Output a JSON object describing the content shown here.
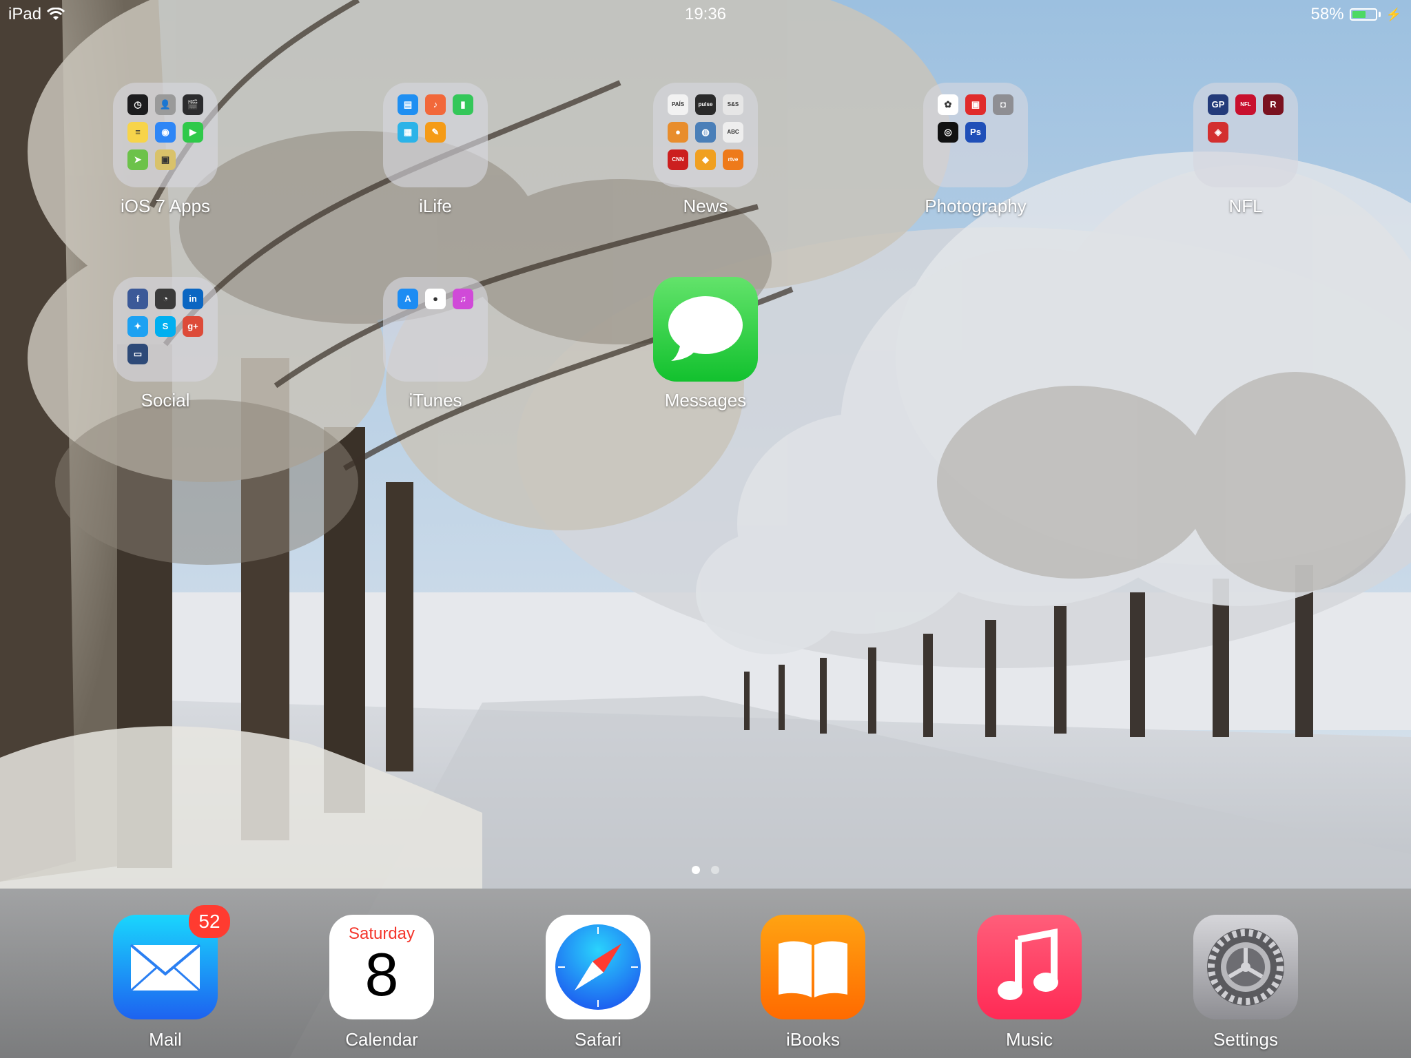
{
  "status_bar": {
    "device": "iPad",
    "time": "19:36",
    "battery": "58%",
    "battery_level": 0.58
  },
  "folders": [
    {
      "label": "iOS 7 Apps",
      "minis": [
        {
          "icon": "clock-icon",
          "color": "#1c1c1e",
          "glyph": "◷"
        },
        {
          "icon": "contacts-icon",
          "color": "#9a9a9a",
          "glyph": "👤"
        },
        {
          "icon": "videos-icon",
          "color": "#2c2c2e",
          "glyph": "🎬"
        },
        {
          "icon": "notes-icon",
          "color": "#f7d44a",
          "glyph": "≡"
        },
        {
          "icon": "wifi-icon",
          "color": "#2e86f6",
          "glyph": "◉"
        },
        {
          "icon": "facetime-icon",
          "color": "#2fc94a",
          "glyph": "▶"
        },
        {
          "icon": "maps-icon",
          "color": "#6cc24a",
          "glyph": "➤"
        },
        {
          "icon": "photo-booth-icon",
          "color": "#d9c26a",
          "glyph": "▣"
        }
      ]
    },
    {
      "label": "iLife",
      "minis": [
        {
          "icon": "keynote-icon",
          "color": "#1f8ff2",
          "glyph": "▤"
        },
        {
          "icon": "garageband-icon",
          "color": "#f2683a",
          "glyph": "♪"
        },
        {
          "icon": "numbers-icon",
          "color": "#34c759",
          "glyph": "▮"
        },
        {
          "icon": "iphoto-icon",
          "color": "#2bb3e8",
          "glyph": "▦"
        },
        {
          "icon": "pages-icon",
          "color": "#f59b16",
          "glyph": "✎"
        }
      ]
    },
    {
      "label": "News",
      "minis": [
        {
          "icon": "el-pais-icon",
          "color": "#f2f2f2",
          "glyph": "PAÍS"
        },
        {
          "icon": "pulse-icon",
          "color": "#2a2a2a",
          "glyph": "pulse"
        },
        {
          "icon": "stars-and-stripes-icon",
          "color": "#e6e6e6",
          "glyph": "S&S"
        },
        {
          "icon": "news-orange-icon",
          "color": "#e88d2c",
          "glyph": "●"
        },
        {
          "icon": "globe-icon",
          "color": "#4a7fb8",
          "glyph": "◍"
        },
        {
          "icon": "abc-icon",
          "color": "#eeeeee",
          "glyph": "ABC"
        },
        {
          "icon": "cnn-icon",
          "color": "#cc1f1f",
          "glyph": "CNN"
        },
        {
          "icon": "news-yellow-icon",
          "color": "#f0a020",
          "glyph": "◆"
        },
        {
          "icon": "rtve-icon",
          "color": "#ee7a1a",
          "glyph": "rtve"
        }
      ]
    },
    {
      "label": "Photography",
      "minis": [
        {
          "icon": "photos-icon",
          "color": "#ffffff",
          "glyph": "✿"
        },
        {
          "icon": "photo-red-icon",
          "color": "#e02b2b",
          "glyph": "▣"
        },
        {
          "icon": "camera-icon",
          "color": "#8e8e93",
          "glyph": "◘"
        },
        {
          "icon": "lens-icon",
          "color": "#111111",
          "glyph": "◎"
        },
        {
          "icon": "photoshop-icon",
          "color": "#1f4fb8",
          "glyph": "Ps"
        }
      ]
    },
    {
      "label": "NFL",
      "minis": [
        {
          "icon": "gamepass-icon",
          "color": "#233b7a",
          "glyph": "GP"
        },
        {
          "icon": "nfl-icon",
          "color": "#c8102e",
          "glyph": "NFL"
        },
        {
          "icon": "redskins-icon",
          "color": "#7a1220",
          "glyph": "R"
        },
        {
          "icon": "nfl-fantasy-icon",
          "color": "#d32f2f",
          "glyph": "◈"
        }
      ]
    },
    {
      "label": "Social",
      "minis": [
        {
          "icon": "facebook-icon",
          "color": "#3b5998",
          "glyph": "f"
        },
        {
          "icon": "hootsuite-icon",
          "color": "#3a3a3a",
          "glyph": "◔"
        },
        {
          "icon": "linkedin-icon",
          "color": "#0a66c2",
          "glyph": "in"
        },
        {
          "icon": "twitter-icon",
          "color": "#1da1f2",
          "glyph": "✦"
        },
        {
          "icon": "skype-icon",
          "color": "#00aff0",
          "glyph": "S"
        },
        {
          "icon": "google-plus-icon",
          "color": "#dd4b39",
          "glyph": "g+"
        },
        {
          "icon": "contacts-card-icon",
          "color": "#2e4a78",
          "glyph": "▭"
        }
      ]
    },
    {
      "label": "iTunes",
      "minis": [
        {
          "icon": "app-store-icon",
          "color": "#1c8cf3",
          "glyph": "A"
        },
        {
          "icon": "game-center-icon",
          "color": "#ffffff",
          "glyph": "●"
        },
        {
          "icon": "itunes-store-icon",
          "color": "#d04ad8",
          "glyph": "♫"
        }
      ]
    }
  ],
  "apps": [
    {
      "label": "Messages"
    }
  ],
  "page_indicator": {
    "pages": 2,
    "current": 1
  },
  "dock": {
    "mail": {
      "label": "Mail",
      "badge": "52"
    },
    "calendar": {
      "label": "Calendar",
      "weekday": "Saturday",
      "day": "8"
    },
    "safari": {
      "label": "Safari"
    },
    "ibooks": {
      "label": "iBooks"
    },
    "music": {
      "label": "Music"
    },
    "settings": {
      "label": "Settings"
    }
  },
  "colors": {
    "messages": "#34c759",
    "mail": "#1e90f5",
    "ibooks": "#fb8c00",
    "music": "#ff2d55",
    "badge": "#ff3b30",
    "battery": "#4cd964"
  }
}
